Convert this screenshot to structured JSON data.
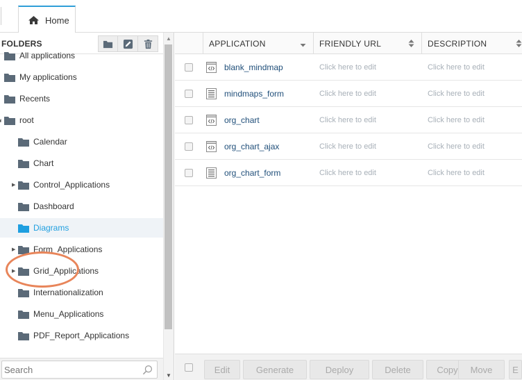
{
  "tabs": [
    {
      "label": "Home",
      "icon": "home-icon",
      "active": true
    }
  ],
  "left_panel": {
    "title": "FOLDERS",
    "header_buttons": [
      {
        "icon": "folder-icon",
        "name": "new-folder-button"
      },
      {
        "icon": "edit-icon",
        "name": "edit-folder-button"
      },
      {
        "icon": "trash-icon",
        "name": "delete-folder-button"
      }
    ],
    "tree": [
      {
        "label": "All applications",
        "level": 0,
        "expander": "none"
      },
      {
        "label": "My applications",
        "level": 0,
        "expander": "none"
      },
      {
        "label": "Recents",
        "level": 0,
        "expander": "none"
      },
      {
        "label": "root",
        "level": 0,
        "expander": "expanded"
      },
      {
        "label": "Calendar",
        "level": 1,
        "expander": "none"
      },
      {
        "label": "Chart",
        "level": 1,
        "expander": "none"
      },
      {
        "label": "Control_Applications",
        "level": 1,
        "expander": "collapsed"
      },
      {
        "label": "Dashboard",
        "level": 1,
        "expander": "none"
      },
      {
        "label": "Diagrams",
        "level": 1,
        "expander": "none",
        "selected": true
      },
      {
        "label": "Form_Applications",
        "level": 1,
        "expander": "collapsed"
      },
      {
        "label": "Grid_Applications",
        "level": 1,
        "expander": "collapsed"
      },
      {
        "label": "Internationalization",
        "level": 1,
        "expander": "none"
      },
      {
        "label": "Menu_Applications",
        "level": 1,
        "expander": "none"
      },
      {
        "label": "PDF_Report_Applications",
        "level": 1,
        "expander": "none"
      }
    ],
    "search": {
      "placeholder": "Search",
      "value": ""
    }
  },
  "grid": {
    "columns": [
      {
        "label": "APPLICATION",
        "sort": "desc"
      },
      {
        "label": "FRIENDLY URL",
        "sort": "both"
      },
      {
        "label": "DESCRIPTION",
        "sort": "both"
      }
    ],
    "rows": [
      {
        "name": "blank_mindmap",
        "icon": "code-file-icon",
        "friendly_url": "Click here to edit",
        "description": "Click here to edit"
      },
      {
        "name": "mindmaps_form",
        "icon": "form-file-icon",
        "friendly_url": "Click here to edit",
        "description": "Click here to edit"
      },
      {
        "name": "org_chart",
        "icon": "code-file-icon",
        "friendly_url": "Click here to edit",
        "description": "Click here to edit"
      },
      {
        "name": "org_chart_ajax",
        "icon": "code-file-icon",
        "friendly_url": "Click here to edit",
        "description": "Click here to edit"
      },
      {
        "name": "org_chart_form",
        "icon": "form-file-icon",
        "friendly_url": "Click here to edit",
        "description": "Click here to edit"
      }
    ],
    "footer_buttons": [
      "Edit",
      "Generate",
      "Deploy",
      "Delete",
      "Copy",
      "Move",
      "E"
    ]
  },
  "colors": {
    "accent": "#2f9fd8",
    "selected_text": "#1f9fe0",
    "folder": "#5b6a78",
    "link_text": "#1f4e79",
    "annotation_ring": "#e8855a"
  }
}
